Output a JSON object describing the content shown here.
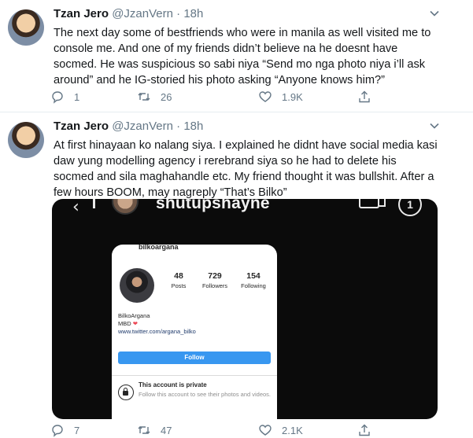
{
  "tweets": [
    {
      "name": "Tzan Jero",
      "handle": "@JzanVern",
      "separator": "·",
      "time": "18h",
      "text": "The next day some of  bestfriends who were in manila as well visited me to console me. And one of my friends didn’t believe na he doesnt have socmed. He was suspicious so sabi niya “Send mo nga photo niya i’ll ask around” and he IG-storied his photo asking “Anyone knows him?”",
      "replies": "1",
      "retweets": "26",
      "likes": "1.9K"
    },
    {
      "name": "Tzan Jero",
      "handle": "@JzanVern",
      "separator": "·",
      "time": "18h",
      "text": "At first hinayaan ko nalang siya. I explained he didnt have social media kasi daw yung modelling agency i rerebrand siya so he had to delete his socmed and sila maghahandle etc. My friend thought it was bullshit. After a few hours BOOM, may nagreply “That’s Bilko”",
      "replies": "7",
      "retweets": "47",
      "likes": "2.1K"
    }
  ],
  "instagram": {
    "story_user": "shutupshayne",
    "story_count": "1",
    "profile_username": "bilkoargana",
    "stats": [
      {
        "number": "48",
        "label": "Posts"
      },
      {
        "number": "729",
        "label": "Followers"
      },
      {
        "number": "154",
        "label": "Following"
      }
    ],
    "bio_name": "BilkoArgana",
    "bio_line": "MBD",
    "bio_heart": "❤",
    "bio_link": "www.twitter.com/argana_bilko",
    "follow_label": "Follow",
    "private_title": "This account is private",
    "private_sub": "Follow this account to see their photos and videos."
  },
  "icons": [
    "chevron-down-icon",
    "reply-icon",
    "retweet-icon",
    "like-icon",
    "share-icon"
  ]
}
